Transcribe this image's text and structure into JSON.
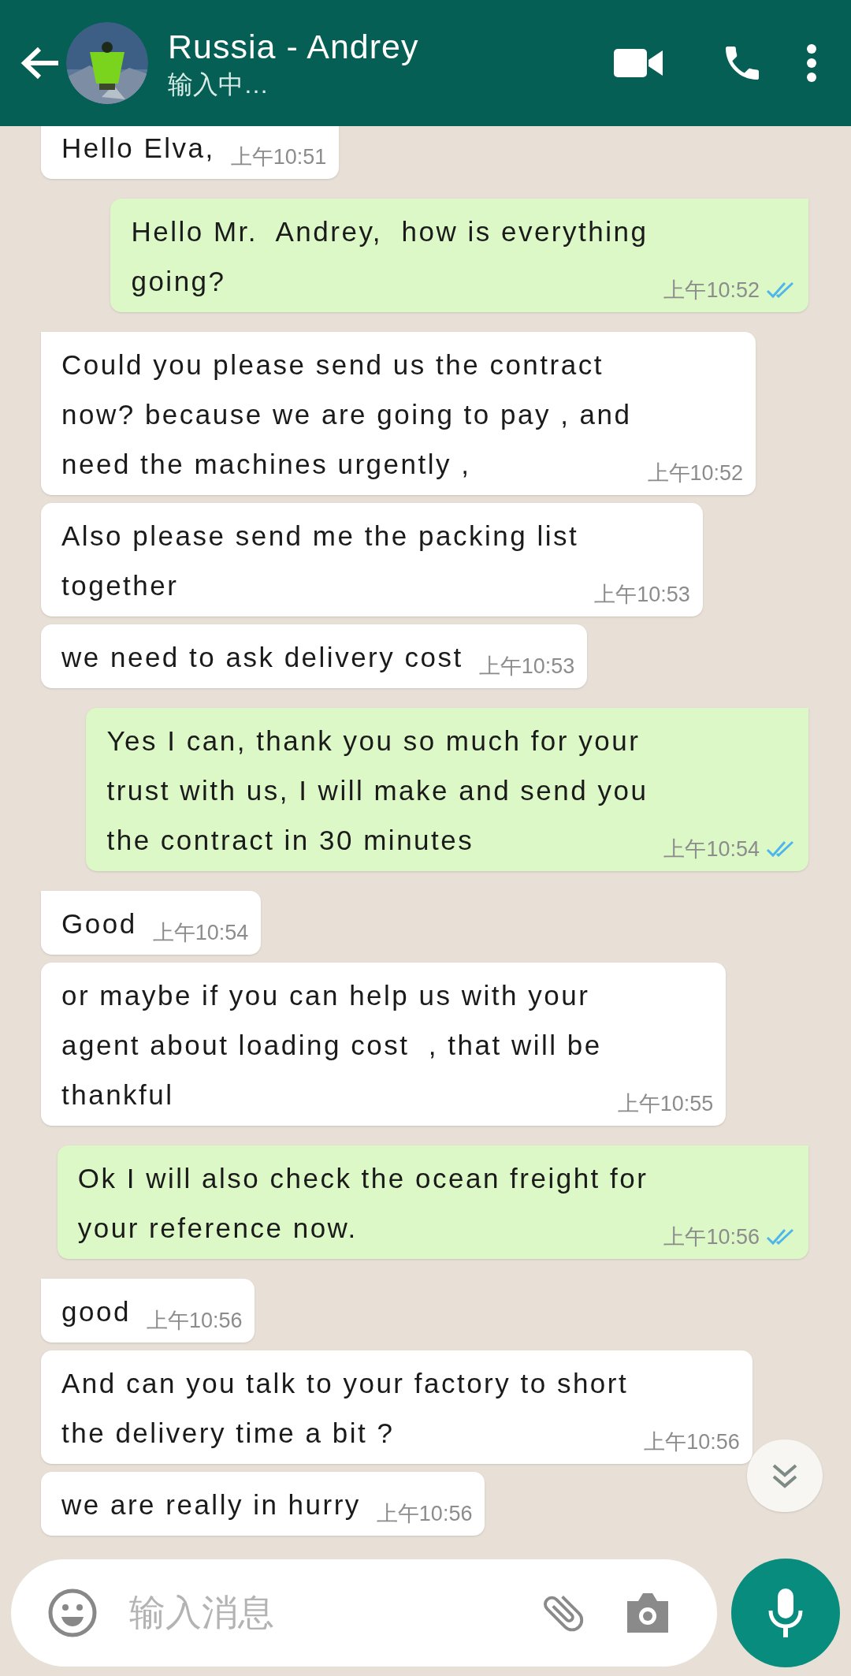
{
  "header": {
    "contact_name": "Russia - Andrey",
    "status": "输入中…"
  },
  "messages": [
    {
      "kind": "incoming",
      "lines": [
        "Hello Elva,"
      ],
      "time": "上午10:51"
    },
    {
      "kind": "outgoing",
      "lines": [
        "Hello Mr.  Andrey,  how is everything",
        "going?"
      ],
      "time": "上午10:52",
      "read": true
    },
    {
      "kind": "incoming",
      "lines": [
        "Could you please send us the contract",
        "now? because we are going to pay , and",
        "need the machines urgently ,"
      ],
      "time": "上午10:52"
    },
    {
      "kind": "incoming",
      "lines": [
        "Also please send me the packing list",
        "together"
      ],
      "time": "上午10:53"
    },
    {
      "kind": "incoming",
      "lines": [
        "we need to ask delivery cost"
      ],
      "time": "上午10:53"
    },
    {
      "kind": "outgoing",
      "lines": [
        "Yes I can, thank you so much for your",
        "trust with us, I will make and send you",
        "the contract in 30 minutes"
      ],
      "time": "上午10:54",
      "read": true
    },
    {
      "kind": "incoming",
      "lines": [
        "Good"
      ],
      "time": "上午10:54"
    },
    {
      "kind": "incoming",
      "lines": [
        "or maybe if you can help us with your",
        "agent about loading cost  , that will be",
        "thankful"
      ],
      "time": "上午10:55"
    },
    {
      "kind": "outgoing",
      "lines": [
        "Ok I will also check the ocean freight for",
        "your reference now."
      ],
      "time": "上午10:56",
      "read": true
    },
    {
      "kind": "incoming",
      "lines": [
        "good"
      ],
      "time": "上午10:56"
    },
    {
      "kind": "incoming",
      "lines": [
        "And can you talk to your factory to short",
        "the delivery time a bit ?"
      ],
      "time": "上午10:56"
    },
    {
      "kind": "incoming",
      "lines": [
        "we are really in hurry"
      ],
      "time": "上午10:56"
    }
  ],
  "composer": {
    "placeholder": "输入消息"
  }
}
